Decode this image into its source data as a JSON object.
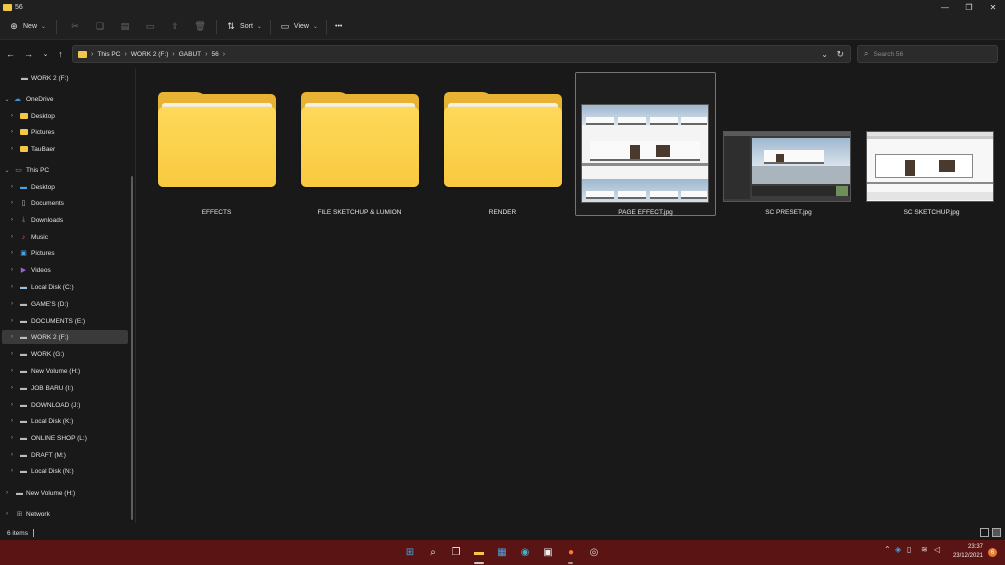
{
  "window": {
    "title": "56"
  },
  "toolbar": {
    "new_label": "New",
    "sort_label": "Sort",
    "view_label": "View",
    "more_label": "•••"
  },
  "address": {
    "crumbs": [
      "This PC",
      "WORK 2 (F:)",
      "GABUT",
      "56"
    ]
  },
  "search": {
    "placeholder": "Search 56"
  },
  "nav": {
    "items": [
      {
        "label": "WORK 2 (F:)"
      },
      {
        "label": "OneDrive"
      },
      {
        "label": "Desktop"
      },
      {
        "label": "Pictures"
      },
      {
        "label": "TauBaer"
      },
      {
        "label": "This PC"
      },
      {
        "label": "Desktop"
      },
      {
        "label": "Documents"
      },
      {
        "label": "Downloads"
      },
      {
        "label": "Music"
      },
      {
        "label": "Pictures"
      },
      {
        "label": "Videos"
      },
      {
        "label": "Local Disk (C:)"
      },
      {
        "label": "GAME'S (D:)"
      },
      {
        "label": "DOCUMENTS (E:)"
      },
      {
        "label": "WORK 2 (F:)"
      },
      {
        "label": "WORK (G:)"
      },
      {
        "label": "New Volume (H:)"
      },
      {
        "label": "JOB BARU (I:)"
      },
      {
        "label": "DOWNLOAD (J:)"
      },
      {
        "label": "Local Disk (K:)"
      },
      {
        "label": "ONLINE SHOP (L:)"
      },
      {
        "label": "DRAFT (M:)"
      },
      {
        "label": "Local Disk (N:)"
      },
      {
        "label": "New Volume (H:)"
      },
      {
        "label": "Network"
      }
    ]
  },
  "files": [
    {
      "name": "EFFECTS"
    },
    {
      "name": "FILE SKETCHUP & LUMION"
    },
    {
      "name": "RENDER"
    },
    {
      "name": "PAGE EFFECT.jpg"
    },
    {
      "name": "SC PRESET.jpg"
    },
    {
      "name": "SC SKETCHUP.jpg"
    }
  ],
  "status": {
    "count": "6 items"
  },
  "taskbar": {
    "time": "23:37",
    "date": "23/12/2021",
    "notifications": "6"
  },
  "colors": {
    "background": "#191919",
    "taskbar": "#5b1414",
    "folder": "#f8c93f"
  }
}
